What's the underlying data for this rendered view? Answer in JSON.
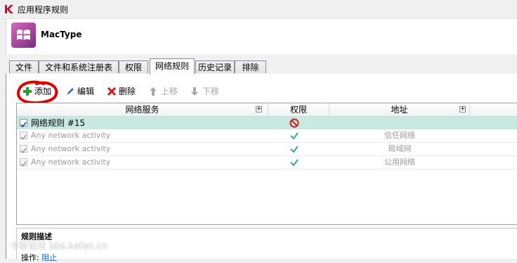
{
  "window": {
    "title": "应用程序规则"
  },
  "header": {
    "app_name": "MacType"
  },
  "tabs": [
    {
      "label": "文件"
    },
    {
      "label": "文件和系统注册表"
    },
    {
      "label": "权限"
    },
    {
      "label": "网络规则",
      "active": true
    },
    {
      "label": "历史记录"
    },
    {
      "label": "排除"
    }
  ],
  "toolbar": {
    "add": "添加",
    "edit": "编辑",
    "delete": "删除",
    "move_up": "上移",
    "move_down": "下移"
  },
  "table": {
    "columns": [
      "网络服务",
      "权限",
      "地址"
    ],
    "rows": [
      {
        "name": "网络规则 #15",
        "permission": "block",
        "address": "",
        "checked": true,
        "selected": true
      },
      {
        "name": "Any network activity",
        "permission": "allow",
        "address": "信任网络",
        "checked": true
      },
      {
        "name": "Any network activity",
        "permission": "allow",
        "address": "局域网",
        "checked": true
      },
      {
        "name": "Any network activity",
        "permission": "allow",
        "address": "公用网络",
        "checked": true
      }
    ]
  },
  "description": {
    "title": "规则描述",
    "operation_label": "操作:",
    "operation_value": "阻止"
  },
  "watermark": "卡饭论坛 bbs.kafan.cn",
  "colors": {
    "selected_row": "#c8e8e2",
    "allow": "#3aa890",
    "block": "#d02020",
    "annotation": "#e00000"
  }
}
